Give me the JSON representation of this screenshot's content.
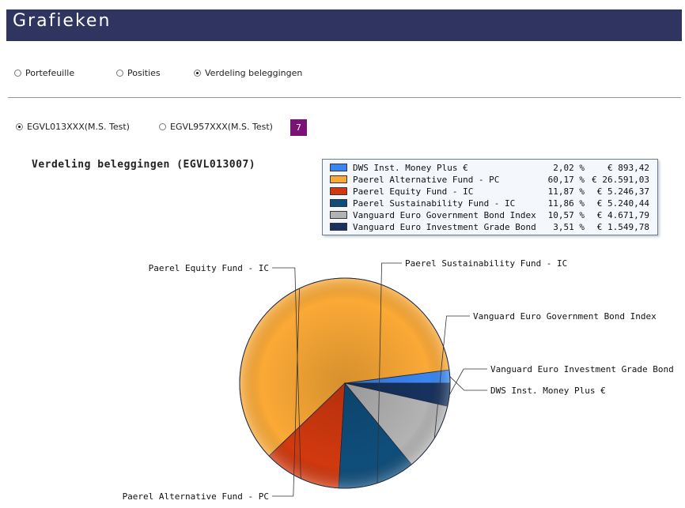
{
  "header": {
    "title": "Grafieken"
  },
  "view_options": [
    {
      "label": "Portefeuille",
      "selected": false
    },
    {
      "label": "Posities",
      "selected": false
    },
    {
      "label": "Verdeling beleggingen",
      "selected": true
    }
  ],
  "accounts": [
    {
      "label": "EGVL013XXX(M.S. Test)",
      "selected": true
    },
    {
      "label": "EGVL957XXX(M.S. Test)",
      "selected": false
    }
  ],
  "account_count": "7",
  "chart_data": {
    "type": "pie",
    "title": "Verdeling beleggingen (EGVL013007)",
    "legend_position": "top-right",
    "slices": [
      {
        "name": "DWS Inst. Money Plus €",
        "percent_label": "2,02 %",
        "amount": "€ 893,42",
        "value": 2.02,
        "color": "#3a86f0"
      },
      {
        "name": "Paerel Alternative Fund  - PC",
        "percent_label": "60,17 %",
        "amount": "€ 26.591,03",
        "value": 60.17,
        "color": "#fba936"
      },
      {
        "name": "Paerel Equity Fund  - IC",
        "percent_label": "11,87 %",
        "amount": "€ 5.246,37",
        "value": 11.87,
        "color": "#d2390f"
      },
      {
        "name": "Paerel Sustainability Fund - IC",
        "percent_label": "11,86 %",
        "amount": "€ 5.240,44",
        "value": 11.86,
        "color": "#0f4e7c"
      },
      {
        "name": "Vanguard Euro Government Bond Index",
        "percent_label": "10,57 %",
        "amount": "€ 4.671,79",
        "value": 10.57,
        "color": "#b3b3b3"
      },
      {
        "name": "Vanguard Euro Investment Grade Bond",
        "percent_label": "3,51 %",
        "amount": "€ 1.549,78",
        "value": 3.51,
        "color": "#17325e"
      }
    ]
  }
}
